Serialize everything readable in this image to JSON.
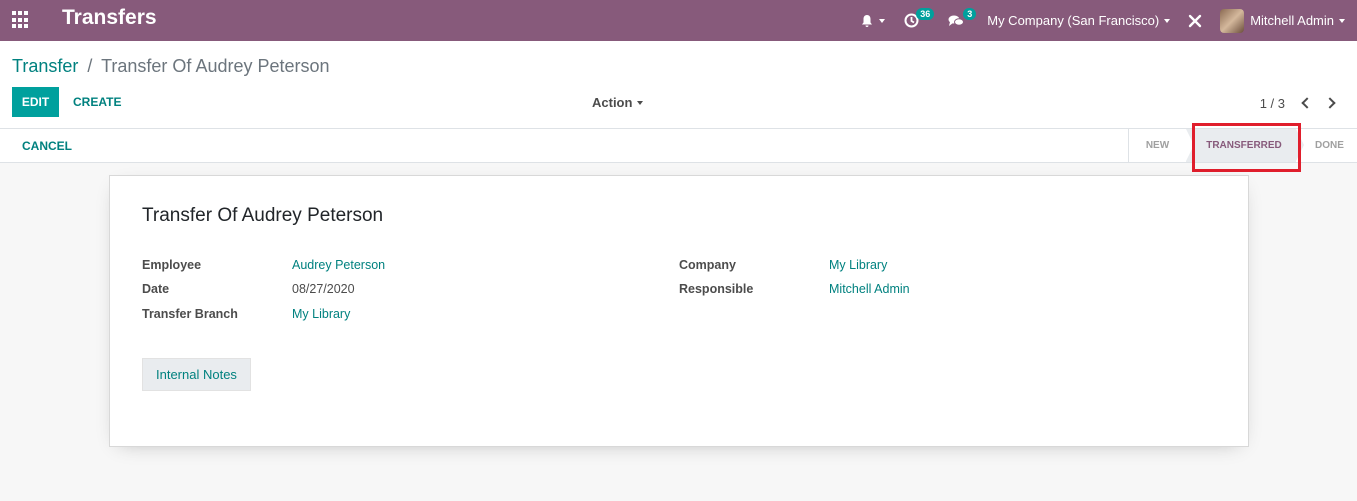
{
  "navbar": {
    "app_title": "Transfers",
    "activity_count": "36",
    "messages_count": "3",
    "company": "My Company (San Francisco)",
    "user": "Mitchell Admin",
    "bg_color": "#875a7b"
  },
  "breadcrumb": {
    "parent": "Transfer",
    "separator": "/",
    "current": "Transfer Of Audrey Peterson"
  },
  "toolbar": {
    "edit_label": "EDIT",
    "create_label": "CREATE",
    "action_label": "Action"
  },
  "pager": {
    "value": "1 / 3"
  },
  "statusbar": {
    "cancel_label": "CANCEL",
    "stages": [
      "NEW",
      "TRANSFERRED",
      "DONE"
    ],
    "active_stage": "TRANSFERRED"
  },
  "form": {
    "title": "Transfer Of Audrey Peterson",
    "employee_label": "Employee",
    "employee_value": "Audrey Peterson",
    "date_label": "Date",
    "date_value": "08/27/2020",
    "branch_label": "Transfer Branch",
    "branch_value": "My Library",
    "company_label": "Company",
    "company_value": "My Library",
    "responsible_label": "Responsible",
    "responsible_value": "Mitchell Admin",
    "notes_tab_label": "Internal Notes"
  },
  "colors": {
    "primary": "#00a09d",
    "link": "#00817f",
    "highlight": "#e01e2c"
  }
}
